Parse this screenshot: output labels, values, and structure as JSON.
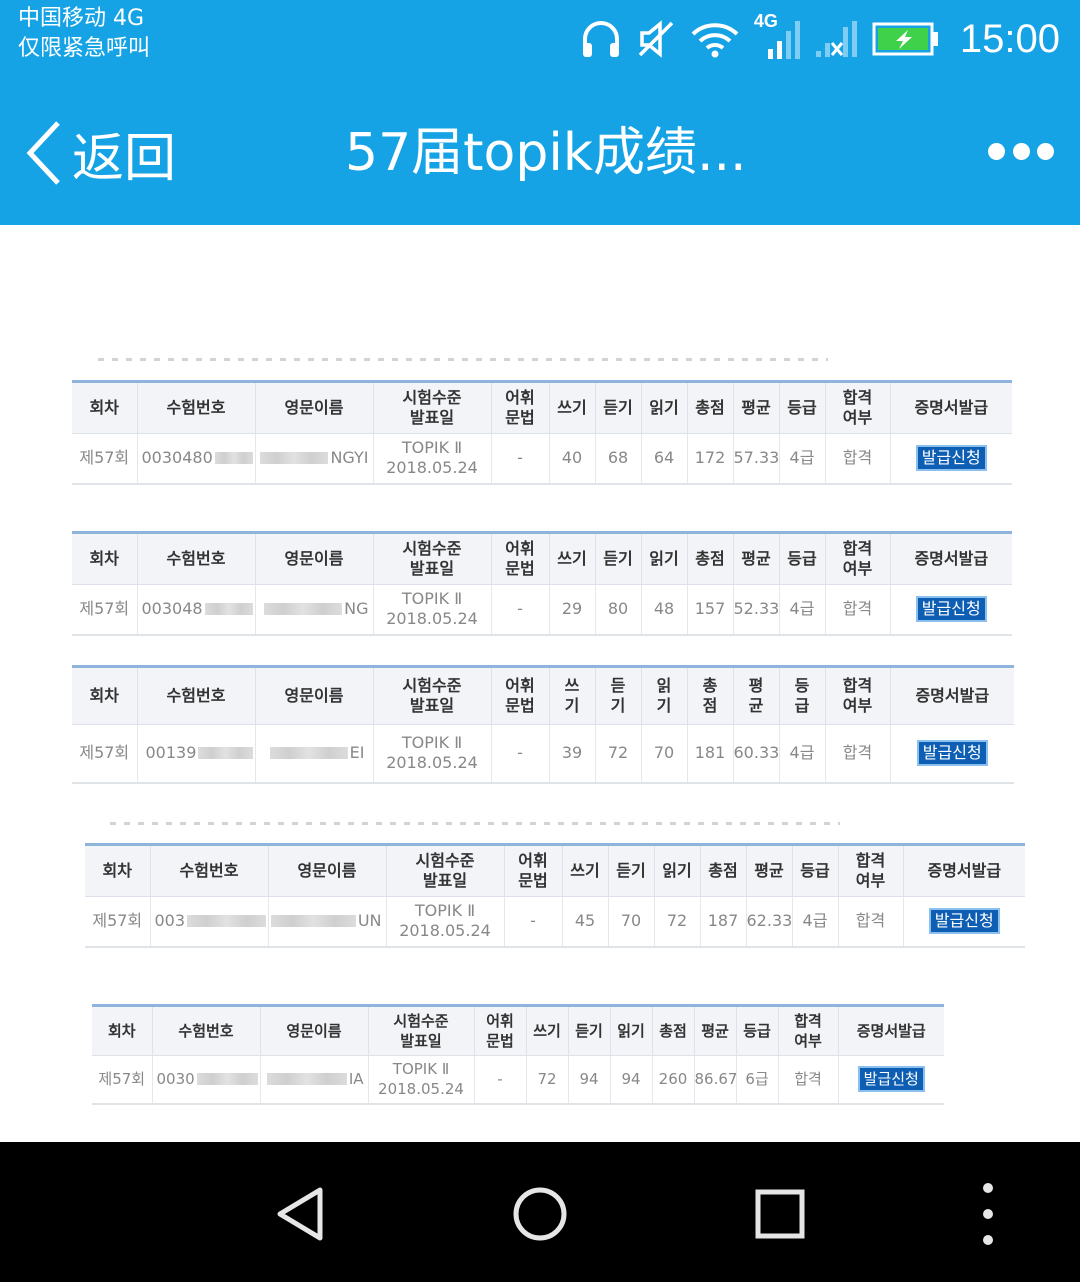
{
  "status_bar": {
    "carrier_line1": "中国移动 4G",
    "carrier_line2": "仅限紧急呼叫",
    "network_label": "4G",
    "time": "15:00",
    "icons": [
      "headphones-icon",
      "mute-icon",
      "wifi-icon",
      "signal-icon",
      "no-signal-icon",
      "battery-charging-icon"
    ]
  },
  "header": {
    "back_label": "返回",
    "title": "57届topik成绩...",
    "more_icon": "more-icon"
  },
  "colors": {
    "header_bg": "#16a3e6",
    "issue_button": "#0e5fb4",
    "table_rule": "#8fb4dc"
  },
  "columns": {
    "round": "회차",
    "exam_no": "수험번호",
    "eng_name": "영문이름",
    "level_line1": "시험수준",
    "level_line2": "발표일",
    "vocab_line1": "어휘",
    "vocab_line2": "문법",
    "writing": "쓰기",
    "listening": "듣기",
    "reading": "읽기",
    "total": "총점",
    "average": "평균",
    "grade": "등급",
    "pass_line1": "합격",
    "pass_line2": "여부",
    "certificate": "증명서발급"
  },
  "columns_split": {
    "writing_1": "쓰",
    "writing_2": "기",
    "listening_1": "듣",
    "listening_2": "기",
    "reading_1": "읽",
    "reading_2": "기",
    "total_1": "총",
    "total_2": "점",
    "average_1": "평",
    "average_2": "균",
    "grade_1": "등",
    "grade_2": "급"
  },
  "results": [
    {
      "round": "제57회",
      "exam_prefix": "0030480",
      "name_suffix": "NGYI",
      "level": "TOPIK Ⅱ",
      "date": "2018.05.24",
      "vocab": "-",
      "writing": "40",
      "listening": "68",
      "reading": "64",
      "total": "172",
      "average": "57.33",
      "grade": "4급",
      "pass": "합격",
      "button": "발급신청"
    },
    {
      "round": "제57회",
      "exam_prefix": "003048",
      "name_suffix": "NG",
      "level": "TOPIK Ⅱ",
      "date": "2018.05.24",
      "vocab": "-",
      "writing": "29",
      "listening": "80",
      "reading": "48",
      "total": "157",
      "average": "52.33",
      "grade": "4급",
      "pass": "합격",
      "button": "발급신청"
    },
    {
      "round": "제57회",
      "exam_prefix": "00139",
      "name_suffix": "EI",
      "level": "TOPIK Ⅱ",
      "date": "2018.05.24",
      "vocab": "-",
      "writing": "39",
      "listening": "72",
      "reading": "70",
      "total": "181",
      "average": "60.33",
      "grade": "4급",
      "pass": "합격",
      "button": "발급신청"
    },
    {
      "round": "제57회",
      "exam_prefix": "003",
      "name_suffix": "UN",
      "level": "TOPIK Ⅱ",
      "date": "2018.05.24",
      "vocab": "-",
      "writing": "45",
      "listening": "70",
      "reading": "72",
      "total": "187",
      "average": "62.33",
      "grade": "4급",
      "pass": "합격",
      "button": "발급신청"
    },
    {
      "round": "제57회",
      "exam_prefix": "0030",
      "name_suffix": "IA",
      "level": "TOPIK Ⅱ",
      "date": "2018.05.24",
      "vocab": "-",
      "writing": "72",
      "listening": "94",
      "reading": "94",
      "total": "260",
      "average": "86.67",
      "grade": "6급",
      "pass": "합격",
      "button": "발급신청"
    }
  ],
  "nav_bar": {
    "icons": [
      "back-triangle-icon",
      "home-circle-icon",
      "recents-square-icon",
      "menu-dots-icon"
    ]
  }
}
